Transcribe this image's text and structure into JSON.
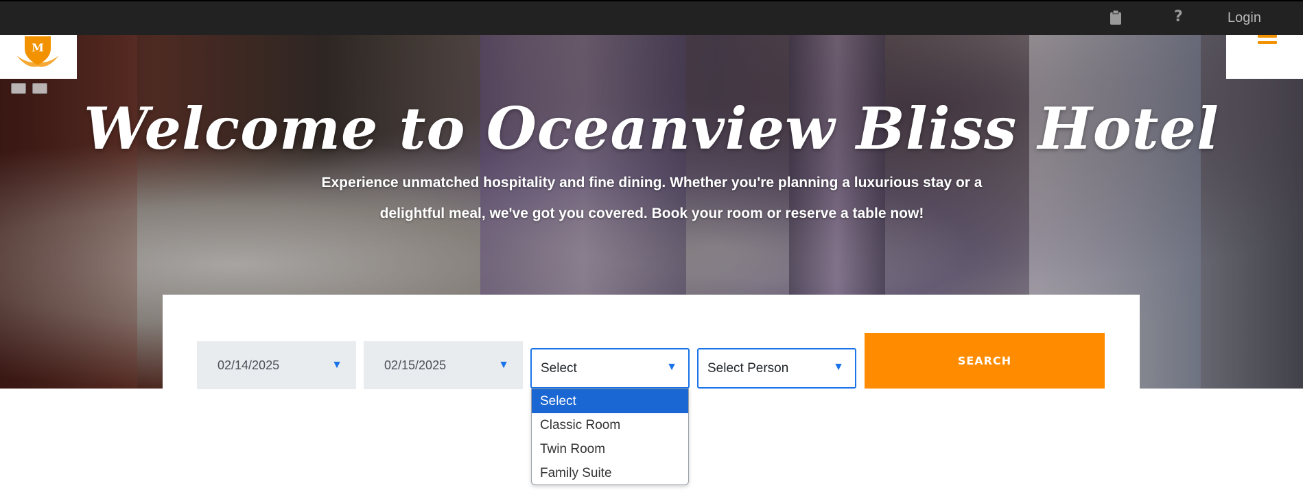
{
  "topbar": {
    "icons": [
      "clipboard-icon",
      "help-icon"
    ],
    "help_glyph": "?",
    "login_label": "Login"
  },
  "brand": {
    "logo_letter": "M",
    "accent_color": "#f39200"
  },
  "hero": {
    "title": "Welcome to Oceanview Bliss Hotel",
    "subtitle": "Experience unmatched hospitality and fine dining. Whether you're planning a luxurious stay or a delightful meal, we've got you covered. Book your room or reserve a table now!"
  },
  "booking": {
    "checkin_date": "02/14/2025",
    "checkout_date": "02/15/2025",
    "room_type_selected": "Select",
    "person_selected": "Select Person",
    "search_label": "SEARCH",
    "room_options": [
      "Select",
      "Classic Room",
      "Twin Room",
      "Family Suite"
    ],
    "highlighted_option": "Select",
    "button_color": "#ff8c00",
    "focus_color": "#1a73e8"
  }
}
